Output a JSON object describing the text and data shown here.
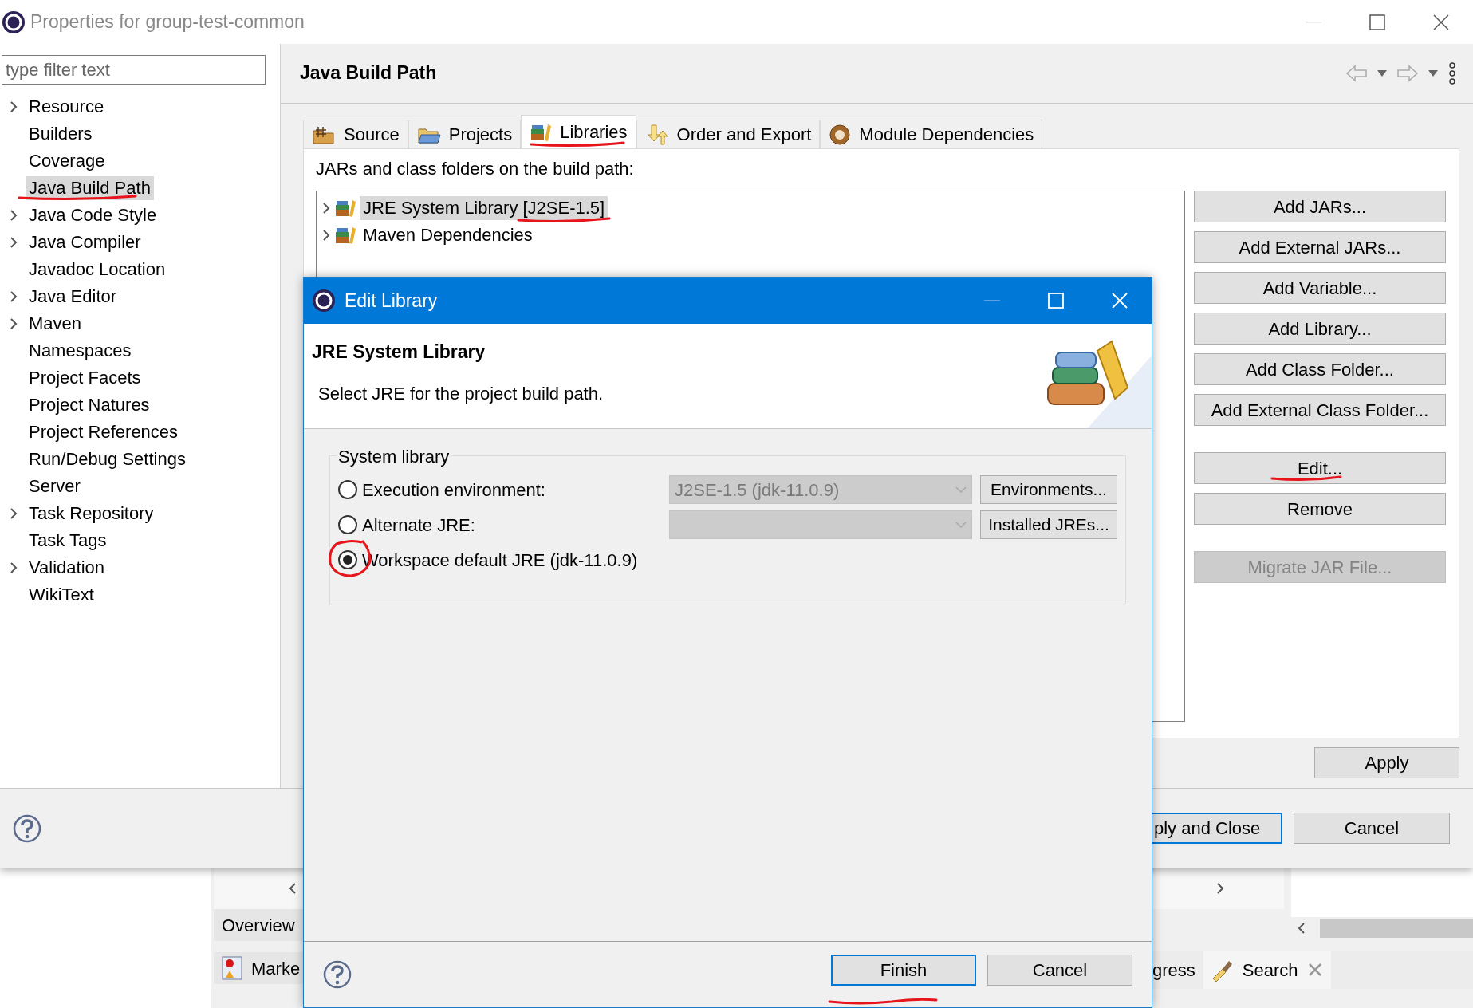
{
  "window": {
    "title": "Properties for group-test-common"
  },
  "filter": {
    "placeholder": "type filter text"
  },
  "nav": [
    {
      "label": "Resource",
      "expandable": true,
      "selected": false,
      "annotated": false
    },
    {
      "label": "Builders",
      "expandable": false,
      "selected": false,
      "annotated": false
    },
    {
      "label": "Coverage",
      "expandable": false,
      "selected": false,
      "annotated": false
    },
    {
      "label": "Java Build Path",
      "expandable": false,
      "selected": true,
      "annotated": true
    },
    {
      "label": "Java Code Style",
      "expandable": true,
      "selected": false,
      "annotated": false
    },
    {
      "label": "Java Compiler",
      "expandable": true,
      "selected": false,
      "annotated": false
    },
    {
      "label": "Javadoc Location",
      "expandable": false,
      "selected": false,
      "annotated": false
    },
    {
      "label": "Java Editor",
      "expandable": true,
      "selected": false,
      "annotated": false
    },
    {
      "label": "Maven",
      "expandable": true,
      "selected": false,
      "annotated": false
    },
    {
      "label": "Namespaces",
      "expandable": false,
      "selected": false,
      "annotated": false
    },
    {
      "label": "Project Facets",
      "expandable": false,
      "selected": false,
      "annotated": false
    },
    {
      "label": "Project Natures",
      "expandable": false,
      "selected": false,
      "annotated": false
    },
    {
      "label": "Project References",
      "expandable": false,
      "selected": false,
      "annotated": false
    },
    {
      "label": "Run/Debug Settings",
      "expandable": false,
      "selected": false,
      "annotated": false
    },
    {
      "label": "Server",
      "expandable": false,
      "selected": false,
      "annotated": false
    },
    {
      "label": "Task Repository",
      "expandable": true,
      "selected": false,
      "annotated": false
    },
    {
      "label": "Task Tags",
      "expandable": false,
      "selected": false,
      "annotated": false
    },
    {
      "label": "Validation",
      "expandable": true,
      "selected": false,
      "annotated": false
    },
    {
      "label": "WikiText",
      "expandable": false,
      "selected": false,
      "annotated": false
    }
  ],
  "page": {
    "title": "Java Build Path"
  },
  "tabs": [
    {
      "label": "Source",
      "kind": "source",
      "selected": false,
      "annotated": false
    },
    {
      "label": "Projects",
      "kind": "projects",
      "selected": false,
      "annotated": false
    },
    {
      "label": "Libraries",
      "kind": "libraries",
      "selected": true,
      "annotated": true
    },
    {
      "label": "Order and Export",
      "kind": "order",
      "selected": false,
      "annotated": false
    },
    {
      "label": "Module Dependencies",
      "kind": "module",
      "selected": false,
      "annotated": false
    }
  ],
  "libraries_label": "JARs and class folders on the build path:",
  "entries": [
    {
      "label": "JRE System Library [J2SE-1.5]",
      "selected": true,
      "expanded": false,
      "annotated": true
    },
    {
      "label": "Maven Dependencies",
      "selected": false,
      "expanded": false,
      "annotated": false
    }
  ],
  "button_groups": [
    [
      {
        "label": "Add JARs...",
        "disabled": false,
        "annotated": false
      },
      {
        "label": "Add External JARs...",
        "disabled": false,
        "annotated": false
      },
      {
        "label": "Add Variable...",
        "disabled": false,
        "annotated": false
      },
      {
        "label": "Add Library...",
        "disabled": false,
        "annotated": false
      },
      {
        "label": "Add Class Folder...",
        "disabled": false,
        "annotated": false
      },
      {
        "label": "Add External Class Folder...",
        "disabled": false,
        "annotated": false
      }
    ],
    [
      {
        "label": "Edit...",
        "disabled": false,
        "annotated": true
      },
      {
        "label": "Remove",
        "disabled": false,
        "annotated": false
      }
    ],
    [
      {
        "label": "Migrate JAR File...",
        "disabled": true,
        "annotated": false
      }
    ]
  ],
  "apply": "Apply",
  "footer": {
    "apply_close": "ply and Close",
    "cancel": "Cancel"
  },
  "dialog": {
    "title": "Edit Library",
    "heading": "JRE System Library",
    "description": "Select JRE for the project build path.",
    "group_title": "System library",
    "options": [
      {
        "label": "Execution environment:",
        "selected": false,
        "annotated": false,
        "combo": "J2SE-1.5 (jdk-11.0.9)",
        "button": "Environments..."
      },
      {
        "label": "Alternate JRE:",
        "selected": false,
        "annotated": false,
        "button": "Installed JREs..."
      },
      {
        "label": "Workspace default JRE (jdk-11.0.9)",
        "selected": true,
        "annotated": true
      }
    ],
    "buttons": [
      {
        "label": "Finish",
        "default": true,
        "annotated": true
      },
      {
        "label": "Cancel",
        "default": false,
        "annotated": false
      }
    ]
  },
  "background": {
    "left_tabs": [
      {
        "label": "Overview",
        "kind": "plain"
      },
      {
        "label": "Marke",
        "kind": "markers"
      }
    ],
    "right_tabs": [
      {
        "label": "gress",
        "kind": "plain",
        "closable": false
      },
      {
        "label": "Search",
        "kind": "search",
        "closable": true
      }
    ]
  }
}
